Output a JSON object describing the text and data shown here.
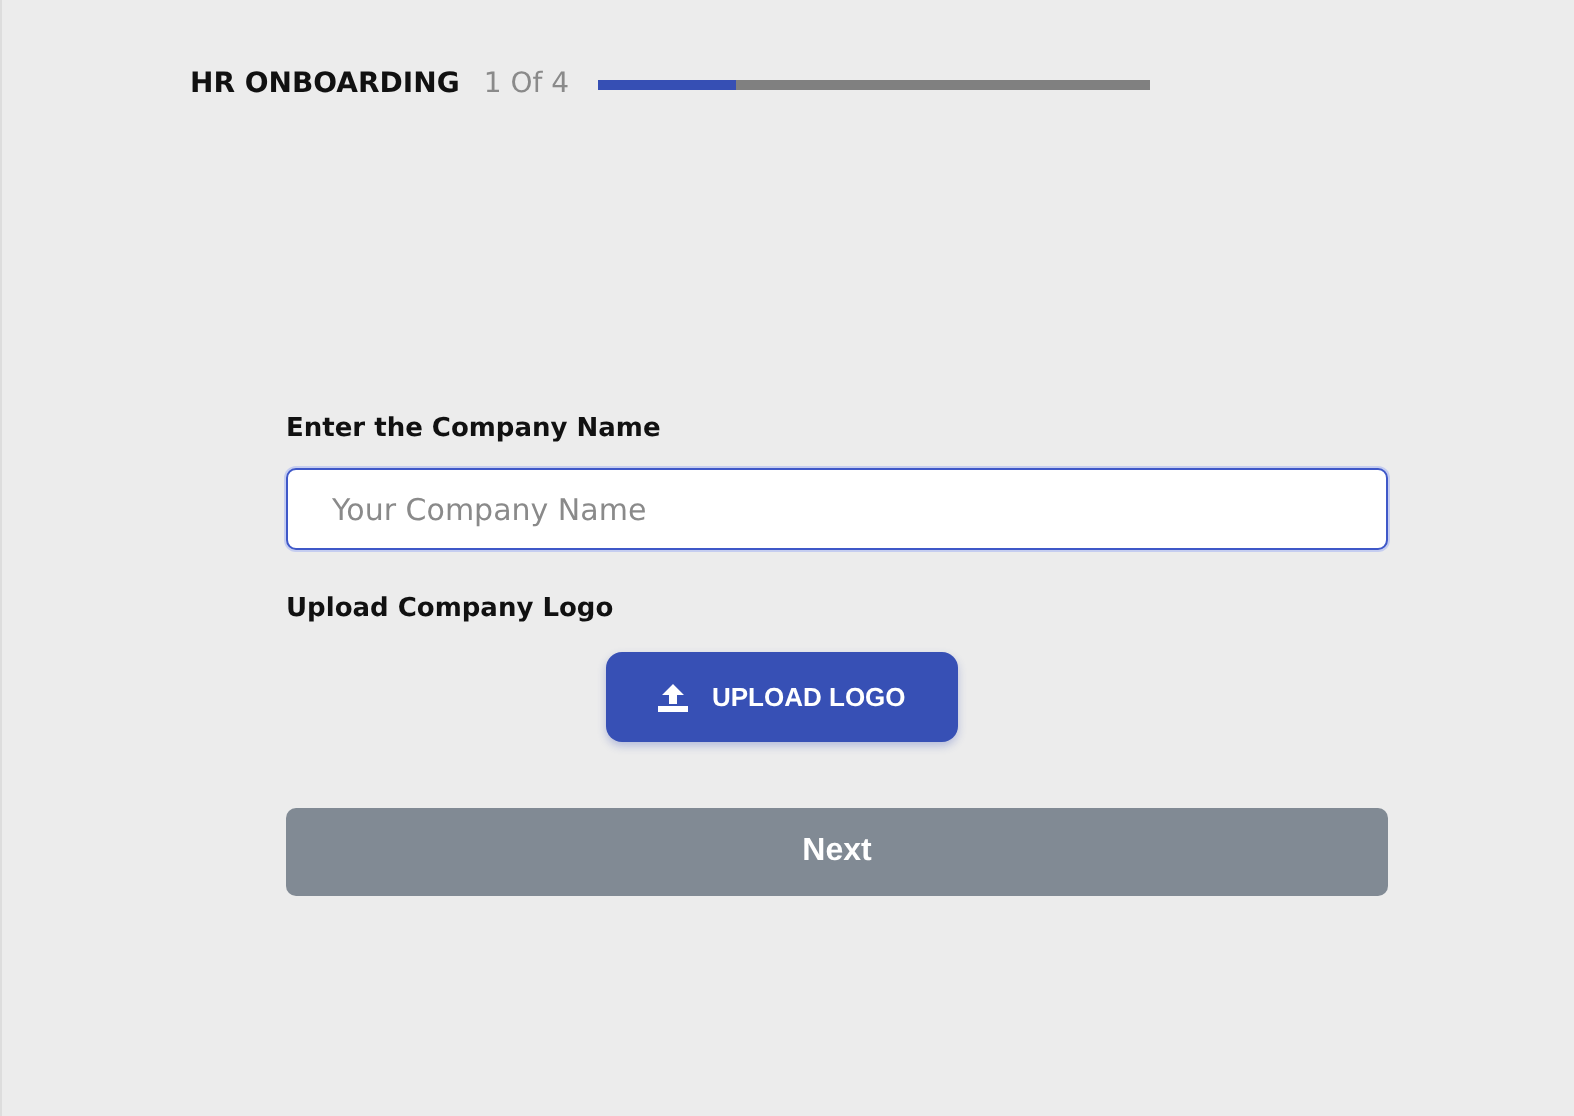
{
  "header": {
    "title": "HR ONBOARDING",
    "step": "1 Of 4",
    "progress": {
      "level": 0.25
    }
  },
  "company_name": {
    "label": "Enter the Company Name",
    "placeholder": "Your Company Name",
    "focused": true
  },
  "logo": {
    "label": "Upload Company Logo",
    "button": "UPLOAD LOGO"
  },
  "next_button": {
    "label": "Next",
    "disabled": true
  }
}
